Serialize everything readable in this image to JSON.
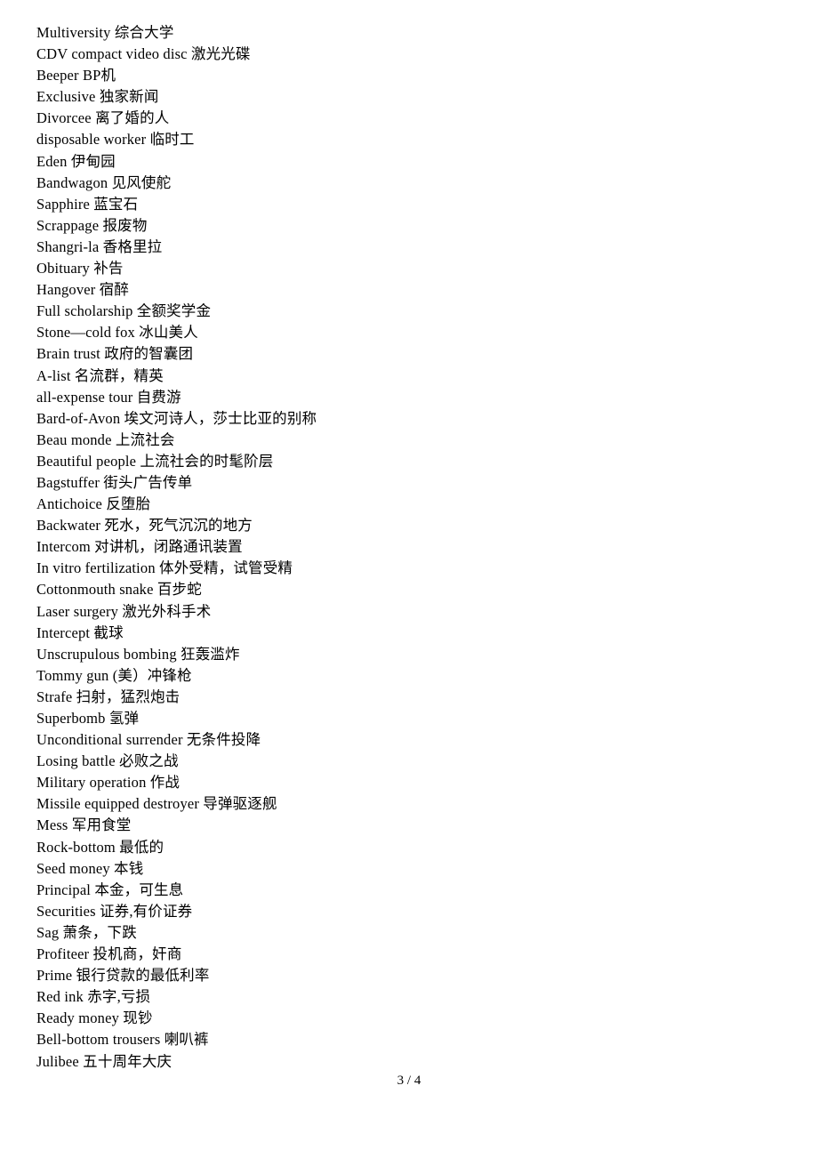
{
  "document": {
    "page_footer": "3 / 4",
    "entries": [
      "Multiversity 综合大学",
      "CDV compact video disc 激光光碟",
      "Beeper BP机",
      "Exclusive 独家新闻",
      "Divorcee 离了婚的人",
      "disposable worker 临时工",
      "Eden 伊甸园",
      "Bandwagon 见风使舵",
      "Sapphire 蓝宝石",
      "Scrappage 报废物",
      "Shangri-la 香格里拉",
      "Obituary 补告",
      "Hangover 宿醉",
      "Full scholarship 全额奖学金",
      "Stone—cold fox 冰山美人",
      "Brain trust 政府的智囊团",
      "A-list 名流群，精英",
      "all-expense tour 自费游",
      "Bard-of-Avon 埃文河诗人，莎士比亚的别称",
      "Beau monde 上流社会",
      "Beautiful people 上流社会的时髦阶层",
      "Bagstuffer 街头广告传单",
      "Antichoice 反堕胎",
      "Backwater 死水，死气沉沉的地方",
      "Intercom 对讲机，闭路通讯装置",
      "In vitro fertilization 体外受精，试管受精",
      "Cottonmouth snake 百步蛇",
      "Laser surgery 激光外科手术",
      "Intercept 截球",
      "Unscrupulous bombing 狂轰滥炸",
      "Tommy gun (美）冲锋枪",
      "Strafe 扫射，猛烈炮击",
      "Superbomb 氢弹",
      "Unconditional surrender 无条件投降",
      "Losing battle 必败之战",
      "Military operation 作战",
      "Missile equipped destroyer 导弹驱逐舰",
      "Mess 军用食堂",
      "Rock-bottom 最低的",
      "Seed money 本钱",
      "Principal 本金，可生息",
      "Securities 证券,有价证券",
      "Sag 萧条，下跌",
      "Profiteer 投机商，奸商",
      "Prime 银行贷款的最低利率",
      "Red ink 赤字,亏损",
      "Ready money 现钞",
      "Bell-bottom trousers 喇叭裤",
      "Julibee 五十周年大庆"
    ]
  }
}
